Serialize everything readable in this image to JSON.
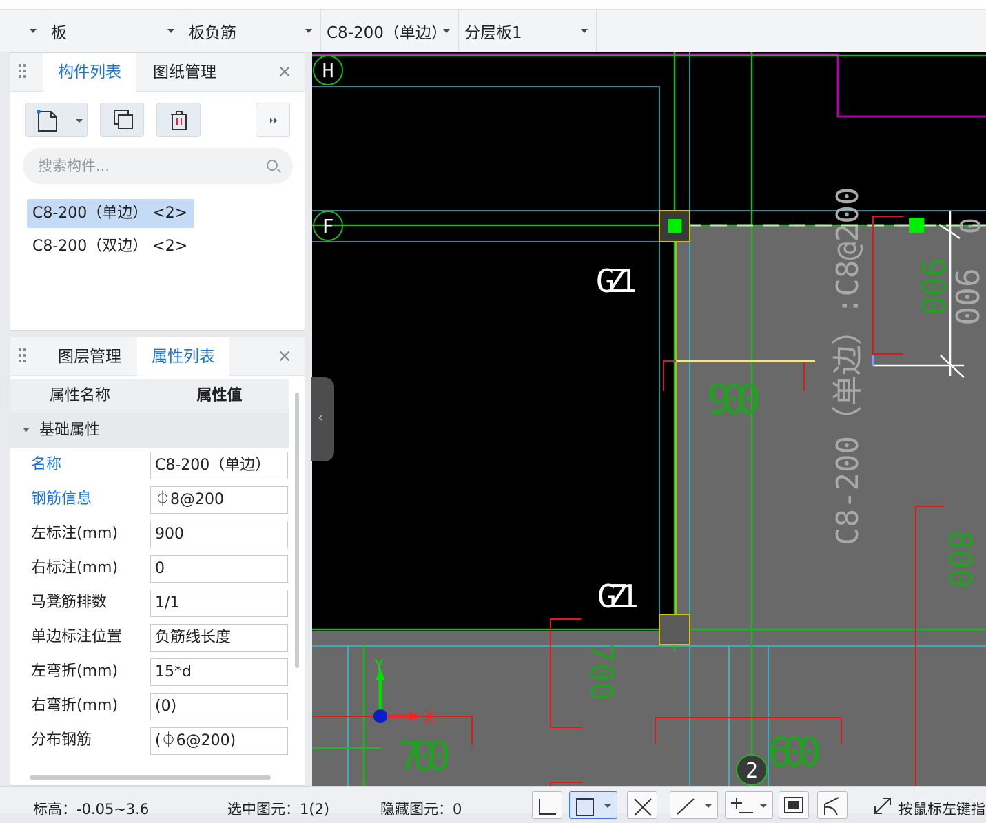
{
  "toolbar": {
    "combos": [
      {
        "label": ""
      },
      {
        "label": "板"
      },
      {
        "label": "板负筋"
      },
      {
        "label": "C8-200（单边）"
      },
      {
        "label": "分层板1"
      }
    ]
  },
  "component_panel": {
    "tabs": [
      "构件列表",
      "图纸管理"
    ],
    "search_placeholder": "搜索构件...",
    "items": [
      "C8-200（单边） <2>",
      "C8-200（双边） <2>"
    ]
  },
  "property_panel": {
    "tabs": [
      "图层管理",
      "属性列表"
    ],
    "headers": [
      "属性名称",
      "属性值"
    ],
    "group": "基础属性",
    "rows": [
      {
        "name": "名称",
        "value": "C8-200（单边）",
        "blue": true
      },
      {
        "name": "钢筋信息",
        "value": "⏀8@200",
        "blue": true
      },
      {
        "name": "左标注(mm)",
        "value": "900",
        "blue": false
      },
      {
        "name": "右标注(mm)",
        "value": "0",
        "blue": false
      },
      {
        "name": "马凳筋排数",
        "value": "1/1",
        "blue": false
      },
      {
        "name": "单边标注位置",
        "value": "负筋线长度",
        "blue": false
      },
      {
        "name": "左弯折(mm)",
        "value": "15*d",
        "blue": false
      },
      {
        "name": "右弯折(mm)",
        "value": "(0)",
        "blue": false
      },
      {
        "name": "分布钢筋",
        "value": "(⏀6@200)",
        "blue": false
      }
    ]
  },
  "canvas": {
    "axis_labels": [
      "H",
      "F",
      "2"
    ],
    "column_labels": [
      "GZ1",
      "GZ1"
    ],
    "rebar_label": "C8-200（单边）:C8@200",
    "dims": [
      "900",
      "900",
      "900",
      "0",
      "800",
      "700",
      "700",
      "600"
    ],
    "axis_x": "X",
    "axis_y": "Y"
  },
  "statusbar": {
    "elevation": "标高：-0.05~3.6",
    "selected": "选中图元：1(2)",
    "hidden": "隐藏图元：0",
    "hint": "按鼠标左键指"
  },
  "colors": {
    "accent": "#1a73d9",
    "canvas_bg": "#000000",
    "slab_fill": "#696969",
    "grid_green": "#22b522",
    "cyan": "#1ec8d8",
    "magenta": "#b000b0",
    "red": "#e01818"
  }
}
